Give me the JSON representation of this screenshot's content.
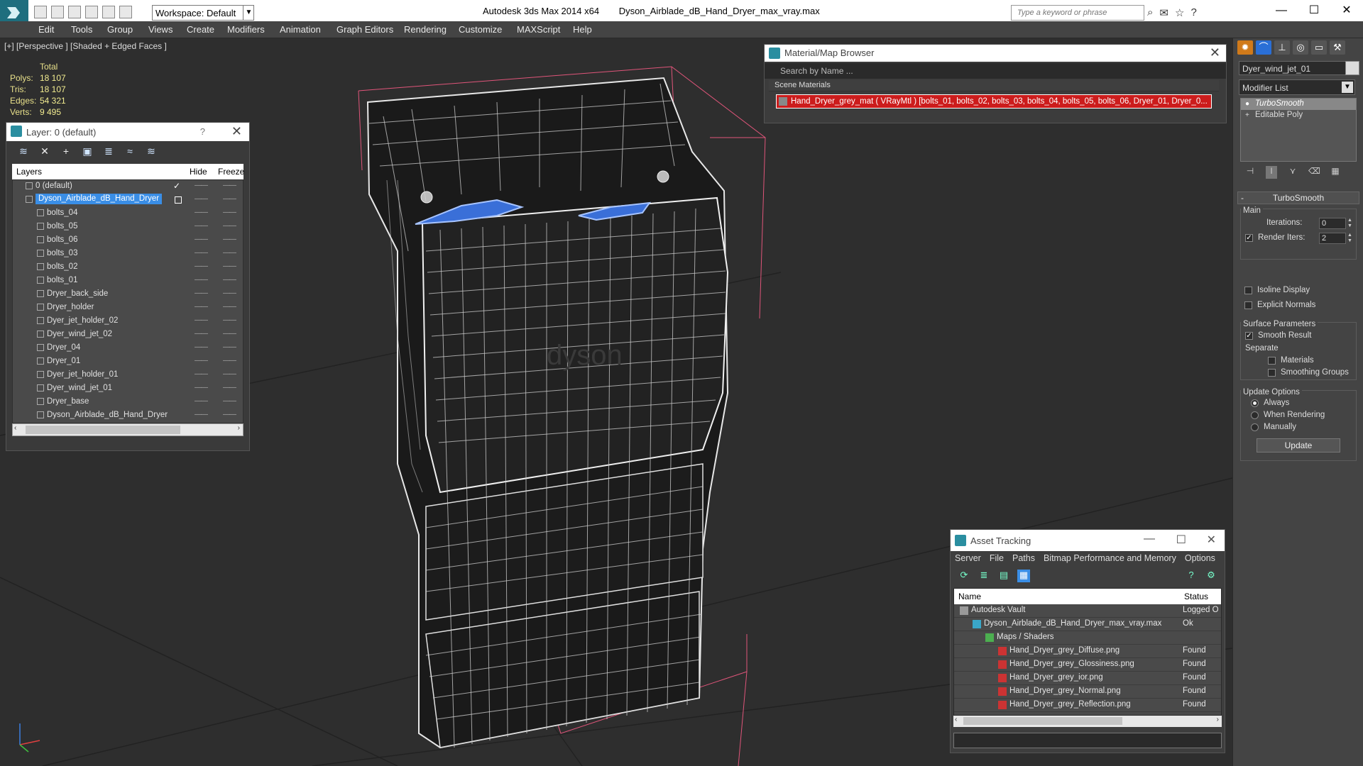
{
  "titlebar": {
    "workspace": "Workspace: Default",
    "app_name": "Autodesk 3ds Max  2014 x64",
    "file_name": "Dyson_Airblade_dB_Hand_Dryer_max_vray.max",
    "search_placeholder": "Type a keyword or phrase"
  },
  "menu": [
    "Edit",
    "Tools",
    "Group",
    "Views",
    "Create",
    "Modifiers",
    "Animation",
    "Graph Editors",
    "Rendering",
    "Customize",
    "MAXScript",
    "Help"
  ],
  "viewport": {
    "label": "[+] [Perspective ] [Shaded + Edged Faces ]",
    "stats": {
      "header": "Total",
      "rows": [
        {
          "k": "Polys:",
          "v": "18 107"
        },
        {
          "k": "Tris:",
          "v": "18 107"
        },
        {
          "k": "Edges:",
          "v": "54 321"
        },
        {
          "k": "Verts:",
          "v": "9 495"
        }
      ]
    },
    "watermark": "dyson"
  },
  "layer_explorer": {
    "title": "Layer: 0 (default)",
    "help": "?",
    "columns": {
      "name": "Layers",
      "hide": "Hide",
      "freeze": "Freeze"
    },
    "rows": [
      {
        "name": "0 (default)",
        "indent": 0,
        "selected": false,
        "check": true
      },
      {
        "name": "Dyson_Airblade_dB_Hand_Dryer",
        "indent": 1,
        "selected": true,
        "check": false
      },
      {
        "name": "bolts_04",
        "indent": 2
      },
      {
        "name": "bolts_05",
        "indent": 2
      },
      {
        "name": "bolts_06",
        "indent": 2
      },
      {
        "name": "bolts_03",
        "indent": 2
      },
      {
        "name": "bolts_02",
        "indent": 2
      },
      {
        "name": "bolts_01",
        "indent": 2
      },
      {
        "name": "Dryer_back_side",
        "indent": 2
      },
      {
        "name": "Dryer_holder",
        "indent": 2
      },
      {
        "name": "Dyer_jet_holder_02",
        "indent": 2
      },
      {
        "name": "Dyer_wind_jet_02",
        "indent": 2
      },
      {
        "name": "Dryer_04",
        "indent": 2
      },
      {
        "name": "Dryer_01",
        "indent": 2
      },
      {
        "name": "Dyer_jet_holder_01",
        "indent": 2
      },
      {
        "name": "Dyer_wind_jet_01",
        "indent": 2
      },
      {
        "name": "Dryer_base",
        "indent": 2
      },
      {
        "name": "Dyson_Airblade_dB_Hand_Dryer",
        "indent": 2
      }
    ]
  },
  "material_browser": {
    "title": "Material/Map Browser",
    "search_placeholder": "Search by Name ...",
    "section": "Scene Materials",
    "item": "Hand_Dryer_grey_mat ( VRayMtl ) [bolts_01, bolts_02, bolts_03, bolts_04, bolts_05, bolts_06, Dryer_01, Dryer_0..."
  },
  "asset_tracking": {
    "title": "Asset Tracking",
    "menu": [
      "Server",
      "File",
      "Paths",
      "Bitmap Performance and Memory",
      "Options"
    ],
    "columns": {
      "name": "Name",
      "status": "Status"
    },
    "rows": [
      {
        "name": "Autodesk Vault",
        "status": "Logged O",
        "indent": 1,
        "icon": "vault-icon"
      },
      {
        "name": "Dyson_Airblade_dB_Hand_Dryer_max_vray.max",
        "status": "Ok",
        "indent": 2,
        "icon": "max-file-icon"
      },
      {
        "name": "Maps / Shaders",
        "status": "",
        "indent": 3,
        "icon": "maps-icon"
      },
      {
        "name": "Hand_Dryer_grey_Diffuse.png",
        "status": "Found",
        "indent": 4,
        "icon": "png-icon"
      },
      {
        "name": "Hand_Dryer_grey_Glossiness.png",
        "status": "Found",
        "indent": 4,
        "icon": "png-icon"
      },
      {
        "name": "Hand_Dryer_grey_ior.png",
        "status": "Found",
        "indent": 4,
        "icon": "png-icon"
      },
      {
        "name": "Hand_Dryer_grey_Normal.png",
        "status": "Found",
        "indent": 4,
        "icon": "png-icon"
      },
      {
        "name": "Hand_Dryer_grey_Reflection.png",
        "status": "Found",
        "indent": 4,
        "icon": "png-icon"
      }
    ]
  },
  "command_panel": {
    "object_name": "Dyer_wind_jet_01",
    "modifier_list": "Modifier List",
    "stack": [
      "TurboSmooth",
      "Editable Poly"
    ],
    "rollout": "TurboSmooth",
    "main": {
      "group": "Main",
      "iterations_label": "Iterations:",
      "iterations": "0",
      "render_iters_label": "Render Iters:",
      "render_iters": "2",
      "render_iters_checked": true,
      "isoline": "Isoline Display",
      "explicit_normals": "Explicit Normals"
    },
    "surface": {
      "group": "Surface Parameters",
      "smooth_result": "Smooth Result",
      "separate": "Separate",
      "materials": "Materials",
      "smoothing_groups": "Smoothing Groups"
    },
    "update": {
      "group": "Update Options",
      "always": "Always",
      "when_rendering": "When Rendering",
      "manually": "Manually",
      "button": "Update"
    }
  },
  "colors": {
    "selection": "#3a8ee6",
    "material_highlight": "#cc1c1c",
    "wire_color": "#ffffff",
    "bbox_color": "#e0557a",
    "stat_text": "#f2ec90"
  }
}
